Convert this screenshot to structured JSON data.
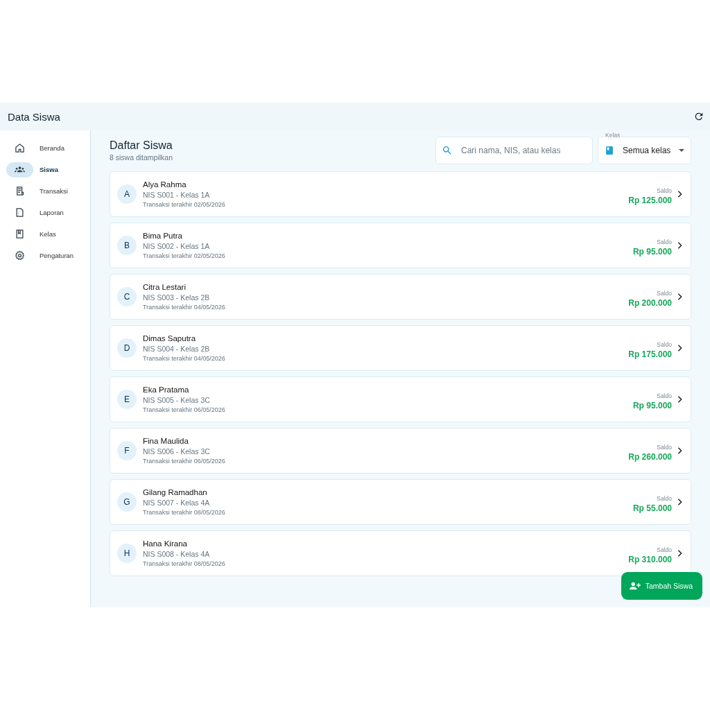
{
  "app_bar": {
    "title": "Data Siswa"
  },
  "sidebar": {
    "items": [
      {
        "label": "Beranda",
        "selected": false
      },
      {
        "label": "Siswa",
        "selected": true
      },
      {
        "label": "Transaksi",
        "selected": false
      },
      {
        "label": "Laporan",
        "selected": false
      },
      {
        "label": "Kelas",
        "selected": false
      },
      {
        "label": "Pengaturan",
        "selected": false
      }
    ]
  },
  "header": {
    "title": "Daftar Siswa",
    "subtitle": "8 siswa ditampilkan"
  },
  "search": {
    "placeholder": "Cari nama, NIS, atau kelas"
  },
  "class_filter": {
    "label": "Kelas",
    "value": "Semua kelas"
  },
  "students": [
    {
      "initial": "A",
      "name": "Alya Rahma",
      "info": "NIS S001 - Kelas 1A",
      "last": "Transaksi terakhir 02/05/2026",
      "balance_label": "Saldo",
      "balance": "Rp 125.000"
    },
    {
      "initial": "B",
      "name": "Bima Putra",
      "info": "NIS S002 - Kelas 1A",
      "last": "Transaksi terakhir 02/05/2026",
      "balance_label": "Saldo",
      "balance": "Rp 95.000"
    },
    {
      "initial": "C",
      "name": "Citra Lestari",
      "info": "NIS S003 - Kelas 2B",
      "last": "Transaksi terakhir 04/05/2026",
      "balance_label": "Saldo",
      "balance": "Rp 200.000"
    },
    {
      "initial": "D",
      "name": "Dimas Saputra",
      "info": "NIS S004 - Kelas 2B",
      "last": "Transaksi terakhir 04/05/2026",
      "balance_label": "Saldo",
      "balance": "Rp 175.000"
    },
    {
      "initial": "E",
      "name": "Eka Pratama",
      "info": "NIS S005 - Kelas 3C",
      "last": "Transaksi terakhir 06/05/2026",
      "balance_label": "Saldo",
      "balance": "Rp 95.000"
    },
    {
      "initial": "F",
      "name": "Fina Maulida",
      "info": "NIS S006 - Kelas 3C",
      "last": "Transaksi terakhir 06/05/2026",
      "balance_label": "Saldo",
      "balance": "Rp 260.000"
    },
    {
      "initial": "G",
      "name": "Gilang Ramadhan",
      "info": "NIS S007 - Kelas 4A",
      "last": "Transaksi terakhir 08/05/2026",
      "balance_label": "Saldo",
      "balance": "Rp 55.000"
    },
    {
      "initial": "H",
      "name": "Hana Kirana",
      "info": "NIS S008 - Kelas 4A",
      "last": "Transaksi terakhir 08/05/2026",
      "balance_label": "Saldo",
      "balance": "Rp 310.000"
    }
  ],
  "add_button": {
    "label": "Tambah Siswa"
  }
}
